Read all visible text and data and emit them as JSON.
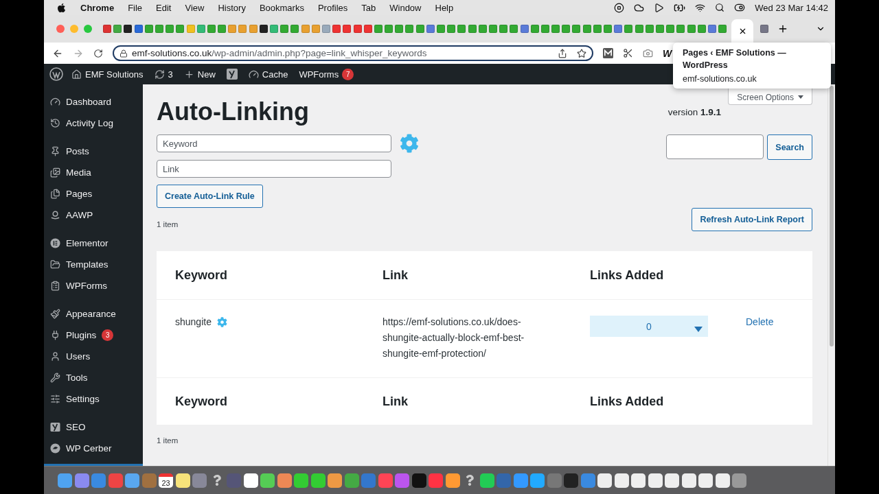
{
  "menu_bar": {
    "app": "Chrome",
    "items": [
      "File",
      "Edit",
      "View",
      "History",
      "Bookmarks",
      "Profiles",
      "Tab",
      "Window",
      "Help"
    ],
    "clock": "Wed 23 Mar  14:42"
  },
  "browser": {
    "url_host": "emf-solutions.co.uk",
    "url_path": "/wp-admin/admin.php?page=link_whisper_keywords",
    "extension_letter": "W"
  },
  "tooltip": {
    "title": "Pages ‹ EMF Solutions — WordPress",
    "host": "emf-solutions.co.uk"
  },
  "admin_bar": {
    "site": "EMF Solutions",
    "updates": "3",
    "new": "New",
    "cache": "Cache",
    "wpforms": "WPForms",
    "wpforms_count": "7"
  },
  "sidebar": {
    "groups": [
      {
        "items": [
          {
            "label": "Dashboard",
            "selected": false
          },
          {
            "label": "Activity Log",
            "selected": false
          }
        ]
      },
      {
        "items": [
          {
            "label": "Posts",
            "selected": false
          },
          {
            "label": "Media",
            "selected": false
          },
          {
            "label": "Pages",
            "selected": false
          },
          {
            "label": "AAWP",
            "selected": false
          }
        ]
      },
      {
        "items": [
          {
            "label": "Elementor",
            "selected": false
          },
          {
            "label": "Templates",
            "selected": false
          },
          {
            "label": "WPForms",
            "selected": false
          }
        ]
      },
      {
        "items": [
          {
            "label": "Appearance",
            "selected": false
          },
          {
            "label": "Plugins",
            "selected": false,
            "badge": "3"
          },
          {
            "label": "Users",
            "selected": false
          },
          {
            "label": "Tools",
            "selected": false
          },
          {
            "label": "Settings",
            "selected": false
          }
        ]
      },
      {
        "items": [
          {
            "label": "SEO",
            "selected": false
          },
          {
            "label": "WP Cerber",
            "selected": false
          }
        ]
      }
    ]
  },
  "page": {
    "title": "Auto-Linking",
    "screen_options": "Screen Options",
    "version_label": "version",
    "version": "1.9.1"
  },
  "form": {
    "keyword_placeholder": "Keyword",
    "link_placeholder": "Link",
    "create_button": "Create Auto-Link Rule"
  },
  "search": {
    "button": "Search"
  },
  "refresh_button": "Refresh Auto-Link Report",
  "item_count_top": "1 item",
  "table": {
    "columns": [
      "Keyword",
      "Link",
      "Links Added"
    ],
    "rows": [
      {
        "keyword": "shungite",
        "link": "https://emf-solutions.co.uk/does-shungite-actually-block-emf-best-shungite-emf-protection/",
        "links_added": "0",
        "action": "Delete"
      }
    ],
    "footer_columns": [
      "Keyword",
      "Link",
      "Links Added"
    ]
  },
  "item_count_bottom": "1 item",
  "dock": {
    "calendar_day": "23"
  }
}
